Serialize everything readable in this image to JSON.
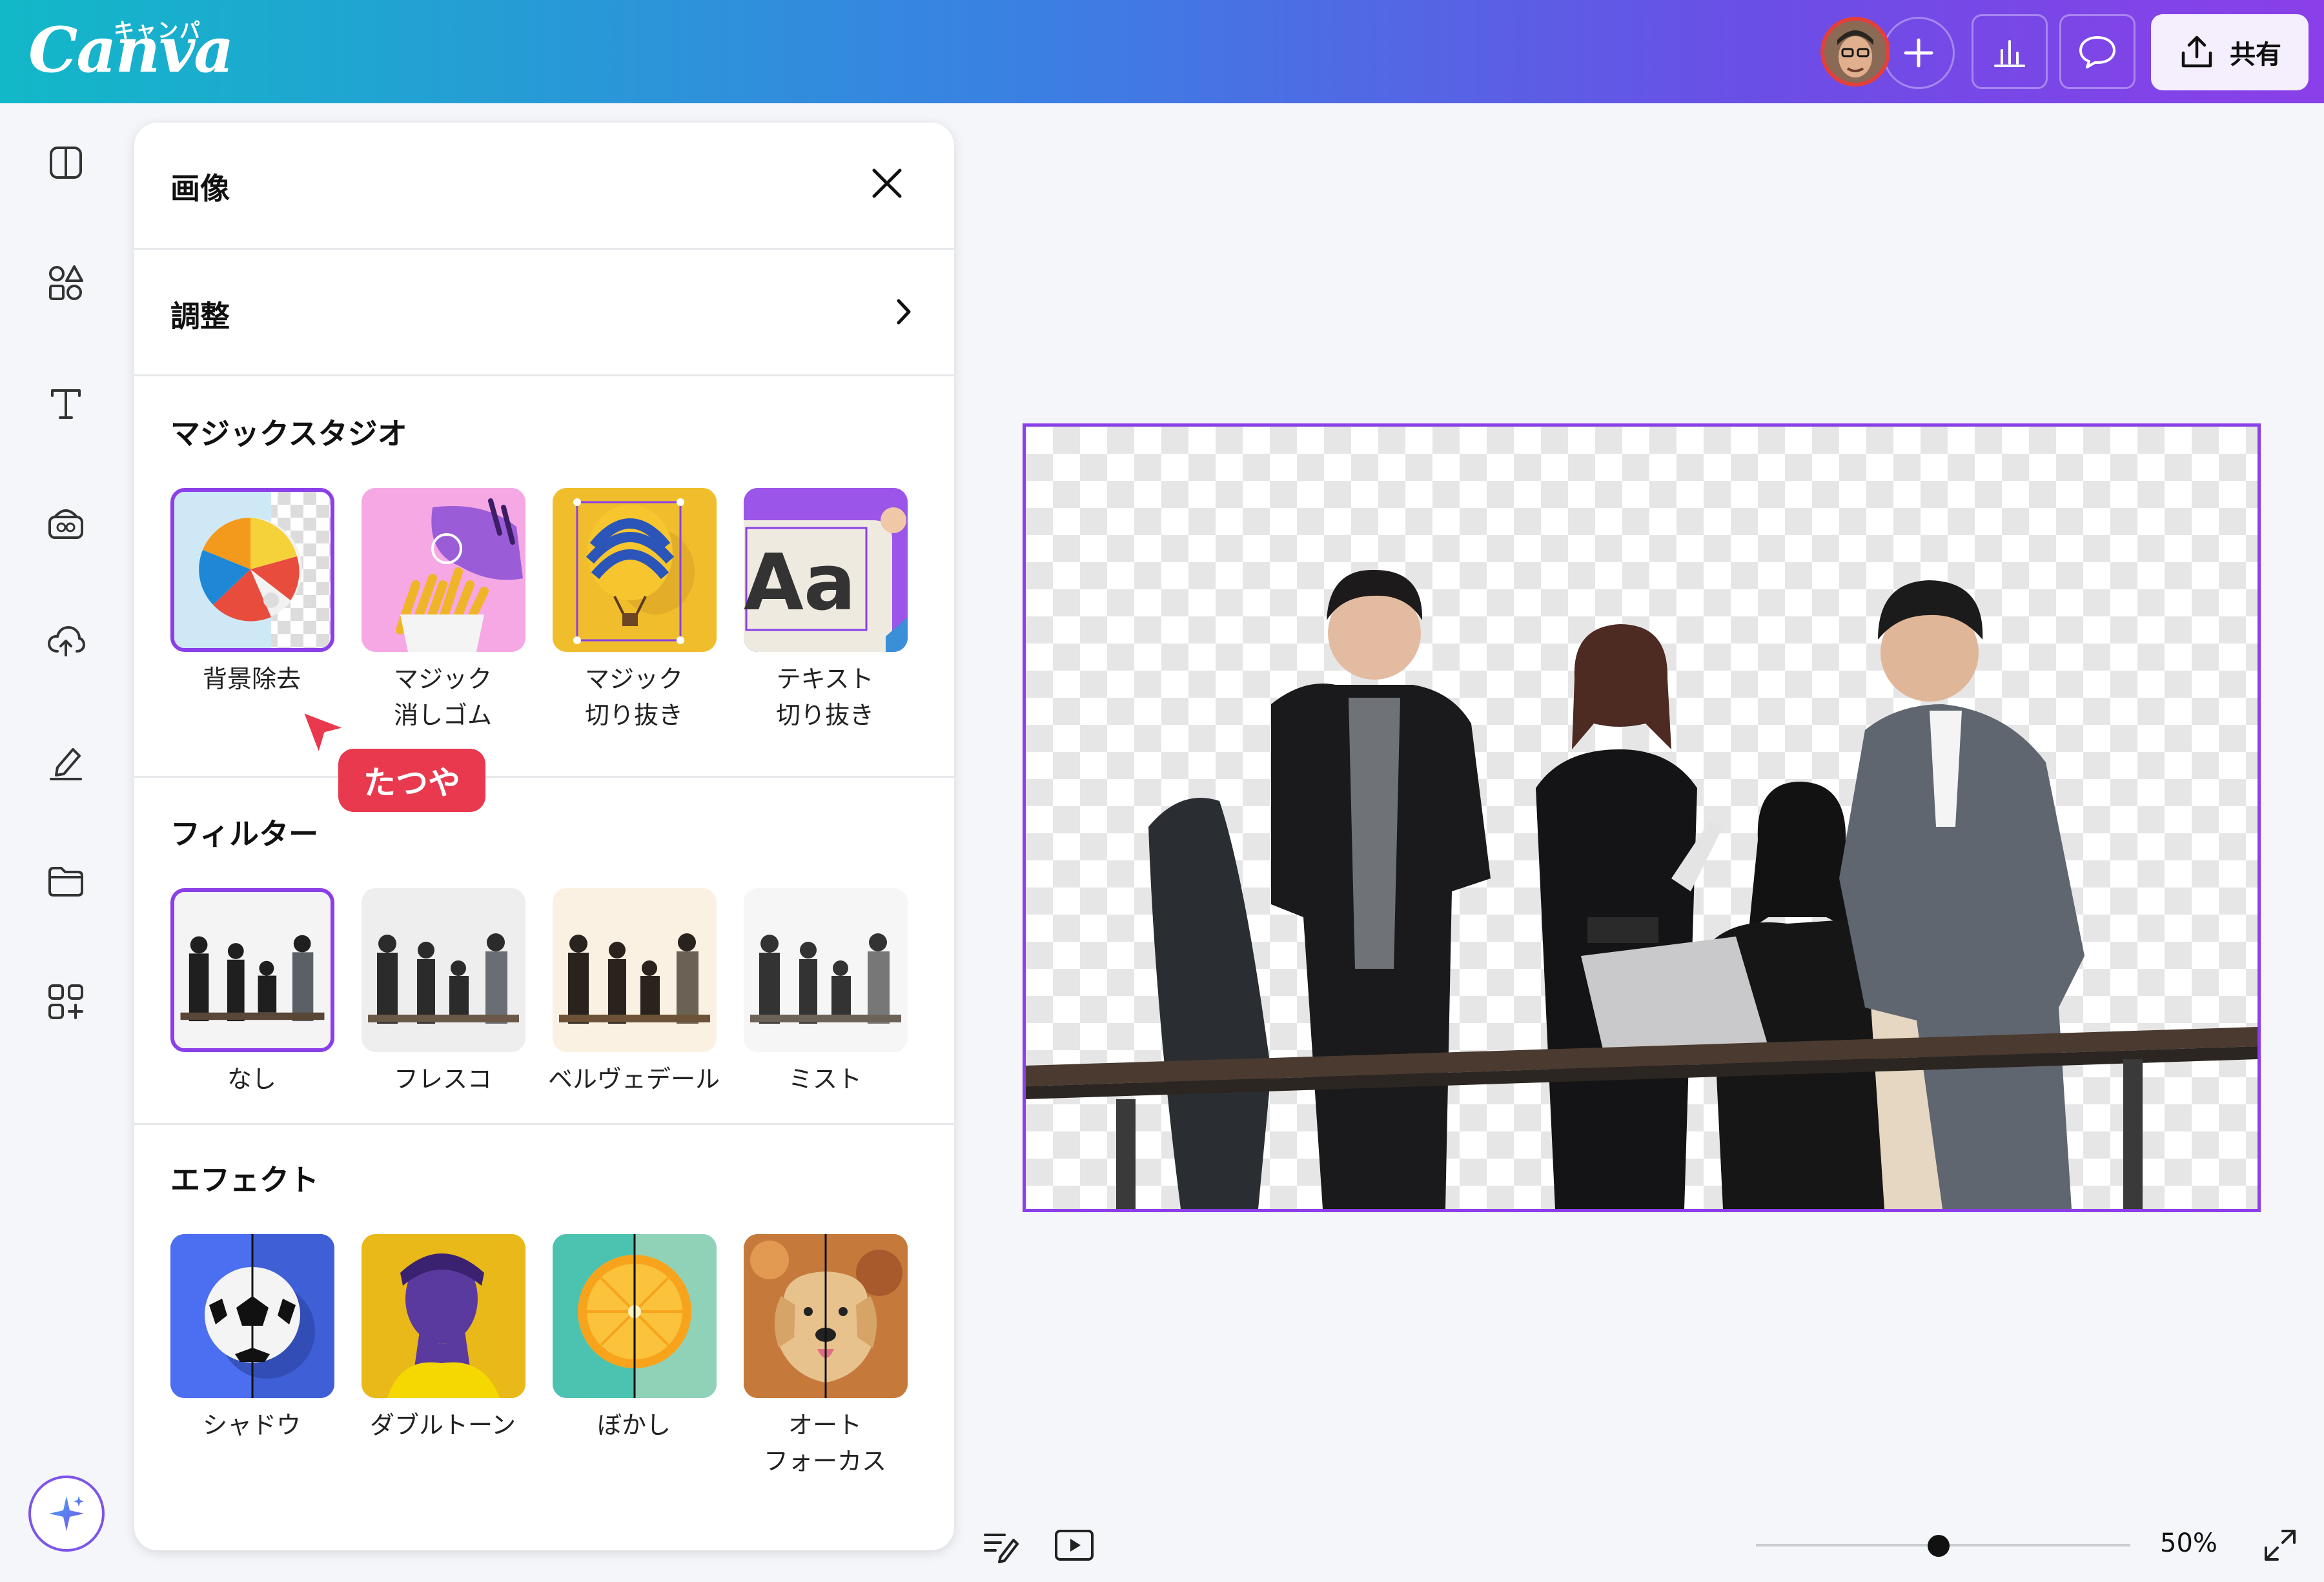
{
  "app": {
    "logo": "Canva",
    "logo_kana": "キャンパ",
    "share_label": "共有"
  },
  "rail": {
    "items": [
      "layout-icon",
      "elements-icon",
      "text-icon",
      "brand-icon",
      "upload-icon",
      "draw-icon",
      "projects-icon",
      "apps-icon"
    ]
  },
  "panel": {
    "title": "画像",
    "adjust_label": "調整",
    "magic_studio": {
      "heading": "マジックスタジオ",
      "items": [
        {
          "label": "背景除去"
        },
        {
          "label1": "マジック",
          "label2": "消しゴム"
        },
        {
          "label1": "マジック",
          "label2": "切り抜き"
        },
        {
          "label1": "テキスト",
          "label2": "切り抜き"
        }
      ]
    },
    "filters": {
      "heading": "フィルター",
      "items": [
        "なし",
        "フレスコ",
        "ベルヴェデール",
        "ミスト"
      ]
    },
    "effects": {
      "heading": "エフェクト",
      "items": [
        {
          "label": "シャドウ"
        },
        {
          "label": "ダブルトーン"
        },
        {
          "label": "ぼかし"
        },
        {
          "label1": "オート",
          "label2": "フォーカス"
        }
      ]
    }
  },
  "cursor_tag": "たつや",
  "zoom": {
    "value": "50%",
    "level": 0.5
  },
  "colors": {
    "accent": "#8b3fe8",
    "tag": "#e8394e",
    "gradient_start": "#12b8c8",
    "gradient_end": "#8a3fe8"
  }
}
